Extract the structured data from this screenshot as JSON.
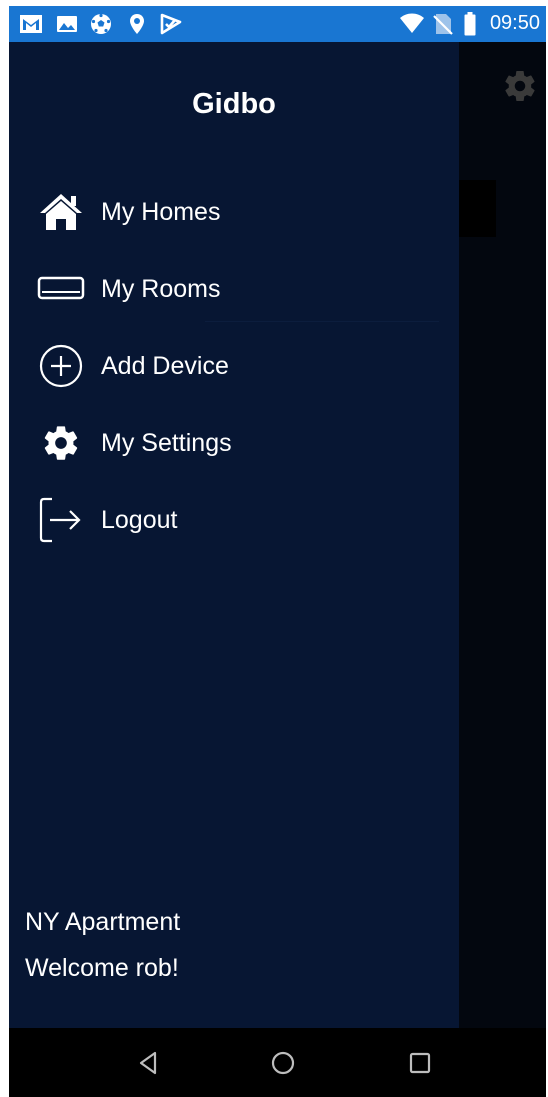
{
  "status_bar": {
    "time": "09:50",
    "colors": {
      "background": "#1976d2",
      "foreground": "#ffffff"
    },
    "left_icons": [
      "gmail-icon",
      "photos-icon",
      "soccer-ball-icon",
      "location-pin-icon",
      "check-flag-icon"
    ],
    "right_icons": [
      "wifi-icon",
      "no-sim-icon",
      "battery-icon"
    ]
  },
  "drawer": {
    "title": "Gidbo",
    "colors": {
      "background": "#071633",
      "text": "#ffffff"
    },
    "items": [
      {
        "label": "My Homes",
        "icon": "home-icon"
      },
      {
        "label": "My Rooms",
        "icon": "room-icon"
      },
      {
        "label": "Add Device",
        "icon": "add-circle-icon"
      },
      {
        "label": "My Settings",
        "icon": "gear-icon"
      },
      {
        "label": "Logout",
        "icon": "logout-icon"
      }
    ],
    "footer": {
      "home_name": "NY Apartment",
      "welcome": "Welcome rob!"
    }
  },
  "background_app": {
    "icon": "gear-icon",
    "colors": {
      "background": "#03070f",
      "icon": "#3a3a3a"
    }
  },
  "nav_bar": {
    "buttons": [
      "back-icon",
      "home-circle-icon",
      "recents-square-icon"
    ],
    "colors": {
      "background": "#000000",
      "icon": "#bdbdbd"
    }
  }
}
